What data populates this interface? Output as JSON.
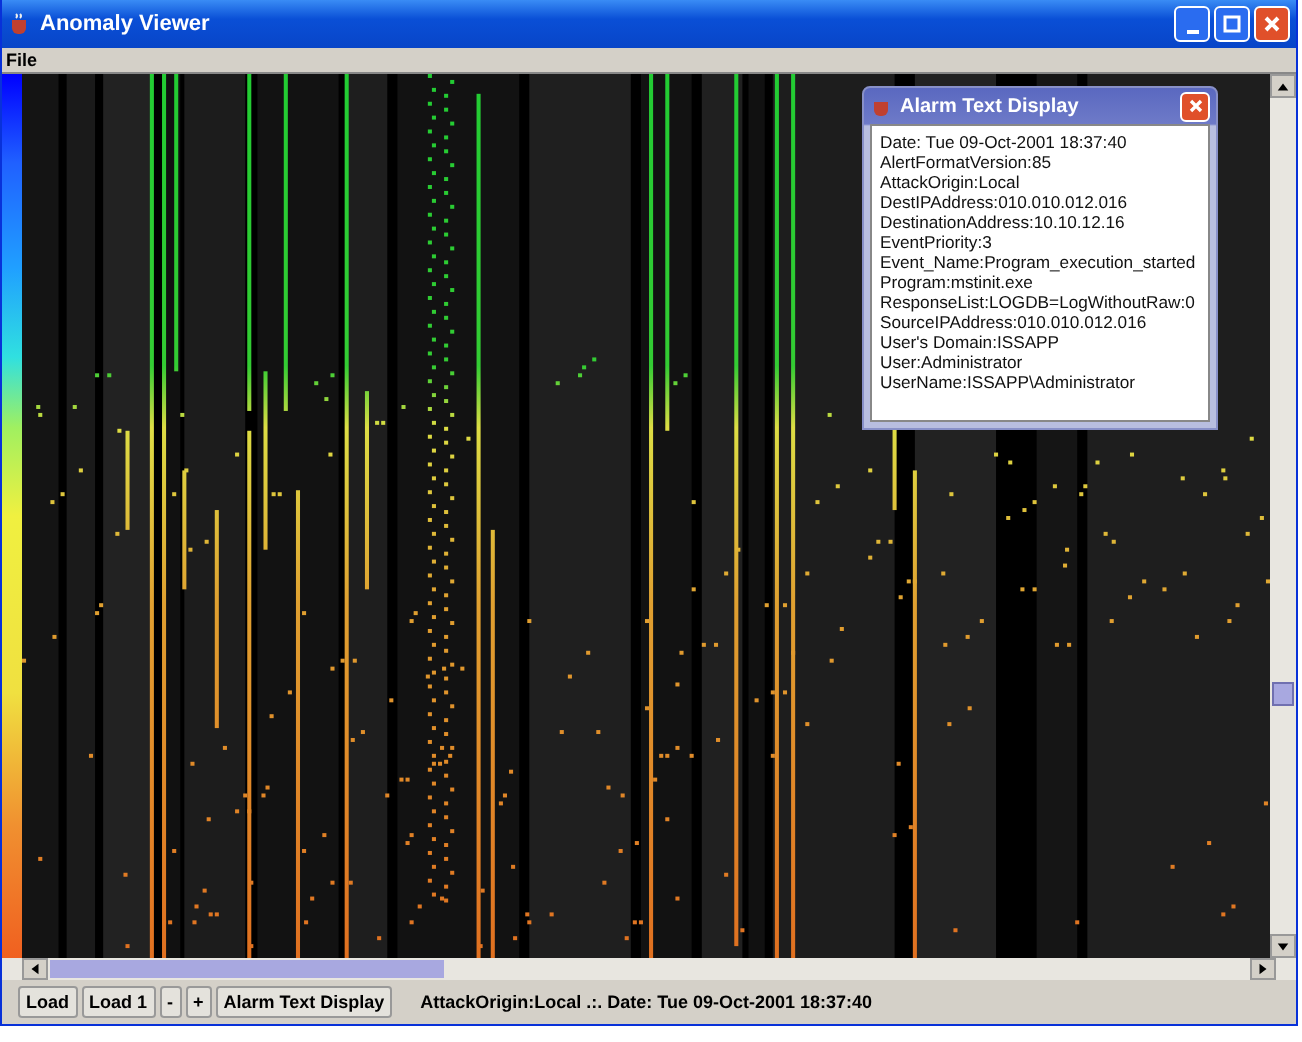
{
  "window": {
    "title": "Anomaly Viewer"
  },
  "menu": [
    "File"
  ],
  "dialog": {
    "title": "Alarm Text Display",
    "lines": [
      "Date: Tue 09-Oct-2001 18:37:40",
      "AlertFormatVersion:85",
      "AttackOrigin:Local",
      "DestIPAddress:010.010.012.016",
      "DestinationAddress:10.10.12.16",
      "EventPriority:3",
      "Event_Name:Program_execution_started",
      "Program:mstinit.exe",
      "ResponseList:LOGDB=LogWithoutRaw:0",
      "SourceIPAddress:010.010.012.016",
      "User's Domain:ISSAPP",
      "User:Administrator",
      "UserName:ISSAPP\\Administrator"
    ]
  },
  "toolbar": {
    "buttons": [
      "Load",
      "Load 1",
      "-",
      "+",
      "Alarm Text Display"
    ],
    "status": "AttackOrigin:Local .:. Date: Tue 09-Oct-2001 18:37:40"
  }
}
